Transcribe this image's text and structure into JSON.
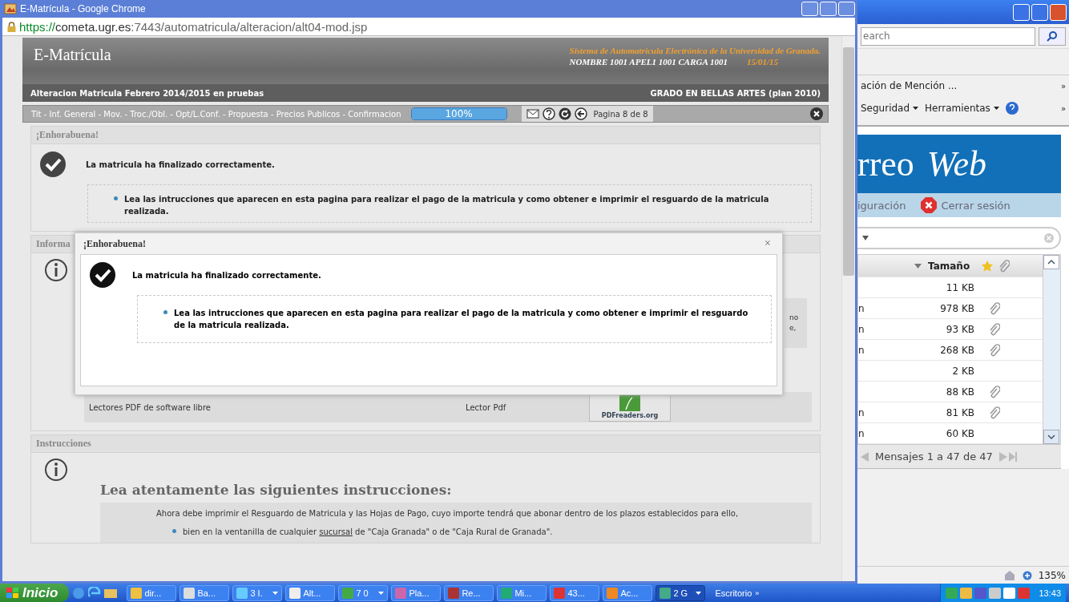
{
  "chrome": {
    "title": "E-Matrícula - Google Chrome",
    "url_scheme": "https://",
    "url_host": "cometa.ugr.es",
    "url_path": ":7443/automatricula/alteracion/alt04-mod.jsp"
  },
  "header": {
    "app_title": "E-Matrícula",
    "system_name": "Sistema de Automatricula Electrónica de la Universidad de Granada.",
    "user": "NOMBRE 1001 APEL1 1001 CARGA 1001",
    "date": "15/01/15",
    "procedure": "Alteracion Matricula Febrero 2014/2015 en pruebas",
    "degree": "GRADO EN BELLAS ARTES (plan 2010)",
    "steps": "Tit - Inf. General - Mov. - Troc./Obl. - Opt/L.Conf. - Propuesta - Precios Publicos - Confirmacion",
    "progress": {
      "label": "100%",
      "level": 1
    },
    "page_indicator": "Pagina 8 de 8"
  },
  "success_panel": {
    "title": "¡Enhorabuena!",
    "message": "La matricula ha finalizado correctamente.",
    "bullets": [
      "Lea las intrucciones que aparecen en esta pagina para realizar el pago de la matricula y como obtener e imprimir el resguardo de la matricula realizada."
    ]
  },
  "info_panel": {
    "title": "Informa",
    "fragments": [
      "no",
      "e,"
    ],
    "pdf_rows": [
      {
        "label": "Lectores PDF de software libre",
        "type": "Lector Pdf",
        "logo": "PDFreaders.org"
      }
    ]
  },
  "modal": {
    "title": "¡Enhorabuena!",
    "close": "×",
    "message": "La matricula ha finalizado correctamente.",
    "bullets": [
      "Lea las intrucciones que aparecen en esta pagina para realizar el pago de la matricula y como obtener e imprimir el resguardo de la matricula realizada."
    ]
  },
  "instructions_panel": {
    "title": "Instrucciones",
    "heading": "Lea atentamente las siguientes instrucciones:",
    "paragraph": "Ahora debe imprimir el Resguardo de Matricula y las Hojas de Pago, cuyo importe tendrá que abonar dentro de los plazos establecidos para ello,",
    "bullets": [
      {
        "before": "bien en la ventanilla de cualquier ",
        "link": "sucursal",
        "after": " de \"Caja Granada\" o de \"Caja Rural de Granada\"."
      }
    ]
  },
  "ie": {
    "search_placeholder": "earch",
    "favorite": "ación de Mención ...",
    "chevron": "»",
    "commands": [
      "Seguridad",
      "Herramientas"
    ],
    "banner_left": "rreo",
    "banner_right": "Web",
    "links": [
      {
        "label": "iguración",
        "kind": "plain"
      },
      {
        "label": "Cerrar sesión",
        "kind": "logout"
      }
    ],
    "column": "Tamaño",
    "rows": [
      {
        "fragment": "",
        "size": "11 KB",
        "attachment": false
      },
      {
        "fragment": "n",
        "size": "978 KB",
        "attachment": true
      },
      {
        "fragment": "n",
        "size": "93 KB",
        "attachment": true
      },
      {
        "fragment": "n",
        "size": "268 KB",
        "attachment": true
      },
      {
        "fragment": "",
        "size": "2 KB",
        "attachment": false
      },
      {
        "fragment": "",
        "size": "88 KB",
        "attachment": true
      },
      {
        "fragment": "n",
        "size": "81 KB",
        "attachment": true
      },
      {
        "fragment": "n",
        "size": "60 KB",
        "attachment": false
      }
    ],
    "pagination": "Mensajes 1 a 47 de 47",
    "zoom": "135%"
  },
  "taskbar": {
    "start": "Inicio",
    "buttons": [
      {
        "label": "dir...",
        "menu": false,
        "selected": false
      },
      {
        "label": "Ba...",
        "menu": false,
        "selected": false
      },
      {
        "label": "3 I.",
        "menu": true,
        "selected": false
      },
      {
        "label": "Alt...",
        "menu": false,
        "selected": false
      },
      {
        "label": "7 0",
        "menu": true,
        "selected": false
      },
      {
        "label": "Pla...",
        "menu": false,
        "selected": false
      },
      {
        "label": "Re...",
        "menu": false,
        "selected": false
      },
      {
        "label": "Mi...",
        "menu": false,
        "selected": false
      },
      {
        "label": "43...",
        "menu": false,
        "selected": false
      },
      {
        "label": "Ac...",
        "menu": false,
        "selected": false
      },
      {
        "label": "2 G",
        "menu": true,
        "selected": true
      }
    ],
    "desktop": "Escritorio",
    "desktop_chevron": "»",
    "clock": "13:43"
  }
}
